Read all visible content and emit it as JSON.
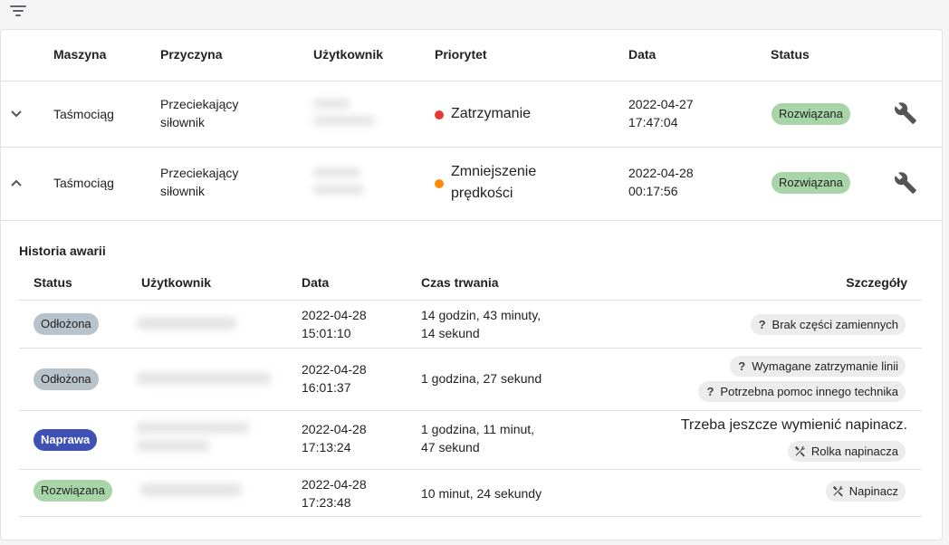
{
  "toolbar": {
    "filter_icon": "filter-list-icon"
  },
  "table": {
    "headers": [
      "Maszyna",
      "Przyczyna",
      "Użytkownik",
      "Priorytet",
      "Data",
      "Status"
    ],
    "rows": [
      {
        "machine": "Taśmociąg",
        "reason_line1": "Przeciekający",
        "reason_line2": "siłownik",
        "priority_line1": "Zatrzymanie",
        "priority_line2": "",
        "priority_color": "#e53935",
        "date": "2022-04-27",
        "time": "17:47:04",
        "status": "Rozwiązana"
      },
      {
        "machine": "Taśmociąg",
        "reason_line1": "Przeciekający",
        "reason_line2": "siłownik",
        "priority_line1": "Zmniejszenie",
        "priority_line2": "prędkości",
        "priority_color": "#fb8c00",
        "date": "2022-04-28",
        "time": "00:17:56",
        "status": "Rozwiązana"
      }
    ]
  },
  "history": {
    "title": "Historia awarii",
    "headers": [
      "Status",
      "Użytkownik",
      "Data",
      "Czas trwania",
      "Szczegóły"
    ],
    "rows": [
      {
        "status": "Odłożona",
        "date": "2022-04-28",
        "time": "15:01:10",
        "duration_line1": "14 godzin, 43 minuty,",
        "duration_line2": "14 sekund",
        "details": [
          "Brak części zamiennych"
        ]
      },
      {
        "status": "Odłożona",
        "date": "2022-04-28",
        "time": "16:01:37",
        "duration_line1": "1 godzina, 27 sekund",
        "duration_line2": "",
        "details": [
          "Wymagane zatrzymanie linii",
          "Potrzebna pomoc innego technika"
        ]
      },
      {
        "status": "Naprawa",
        "date": "2022-04-28",
        "time": "17:13:24",
        "duration_line1": "1 godzina, 11 minut,",
        "duration_line2": "47 sekund",
        "note": "Trzeba jeszcze wymienić napinacz.",
        "details": [
          "Rolka napinacza"
        ]
      },
      {
        "status": "Rozwiązana",
        "date": "2022-04-28",
        "time": "17:23:48",
        "duration_line1": "10 minut, 24 sekundy",
        "duration_line2": "",
        "details": [
          "Napinacz"
        ]
      }
    ]
  },
  "colors": {
    "resolved": "#a8d5a8",
    "postponed": "#b8c2cb",
    "repair": "#3f51b5"
  }
}
